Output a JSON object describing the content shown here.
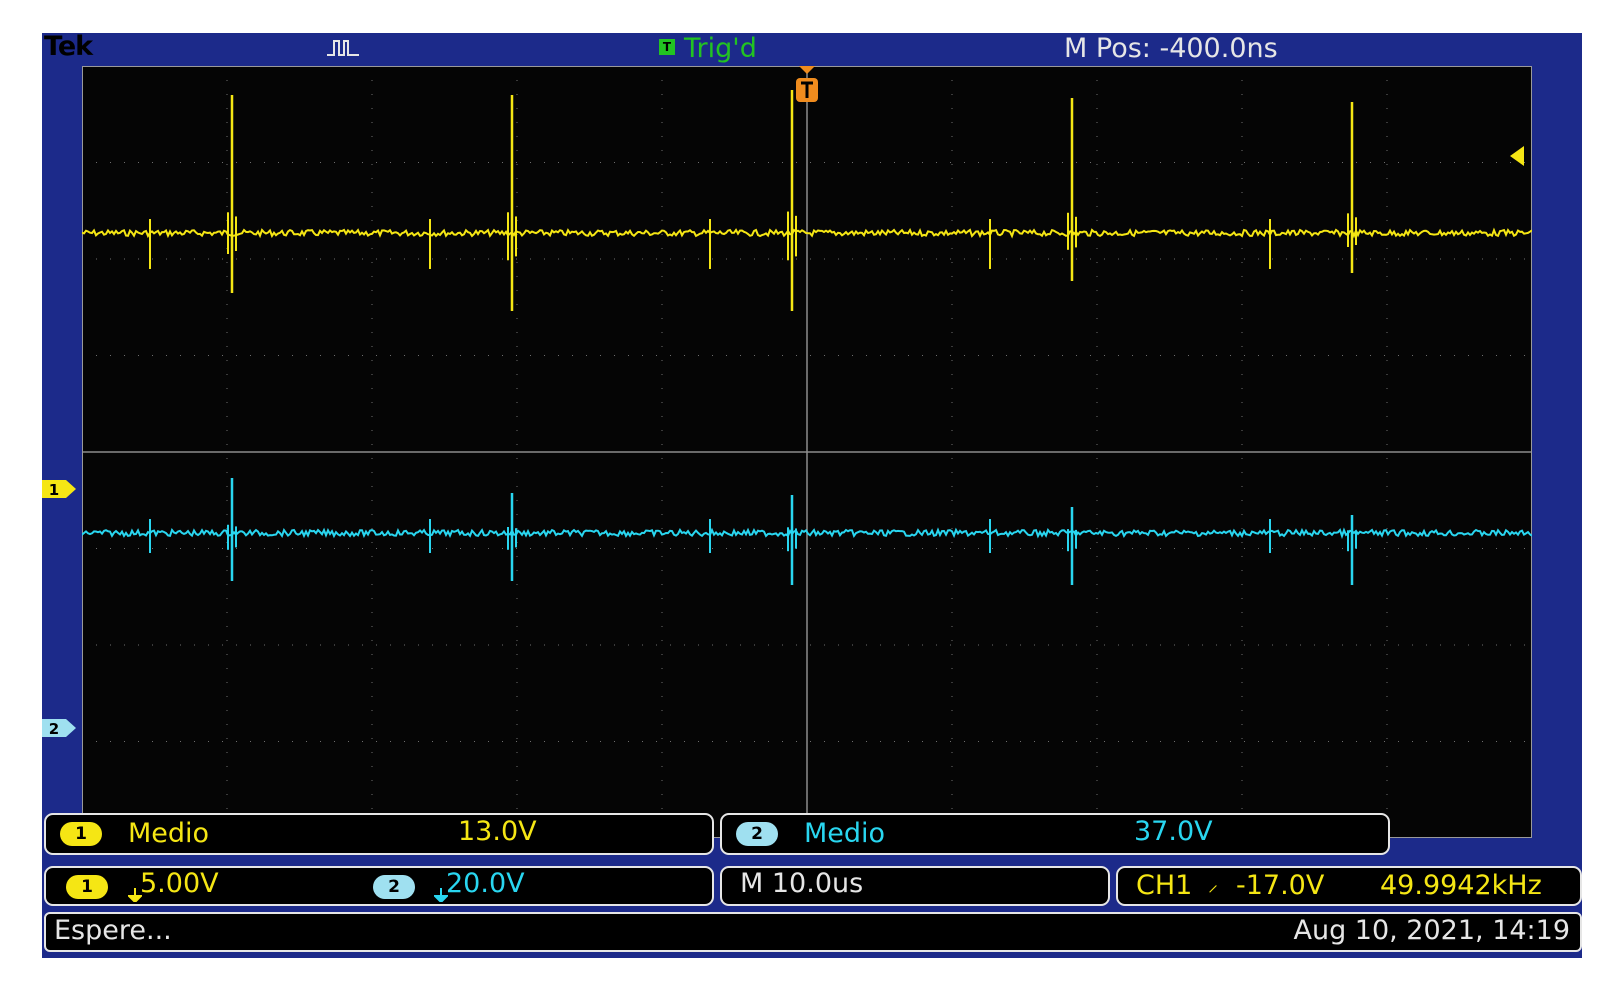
{
  "header": {
    "brand": "Tek",
    "trigger_state": "Trig'd",
    "trigger_badge": "T",
    "horizontal_position": "M Pos: -400.0ns"
  },
  "channels": {
    "ch1": {
      "badge": "1",
      "color": "#f5e614",
      "meas_label": "Medio",
      "meas_value": "13.0V",
      "scale": "5.00V"
    },
    "ch2": {
      "badge": "2",
      "color": "#29d6f0",
      "meas_label": "Medio",
      "meas_value": "37.0V",
      "scale": "20.0V"
    }
  },
  "timebase": "M 10.0us",
  "trigger": {
    "source": "CH1",
    "slope_symbol": "⸝",
    "level": "-17.0V",
    "frequency": "49.9942kHz"
  },
  "status": {
    "message": "Espere...",
    "datetime": "Aug 10, 2021, 14:19"
  },
  "icons": {
    "acquisition": "pulse-icon",
    "trigger_position": "trigger-marker-icon",
    "trigger_level": "trigger-level-arrow-icon"
  }
}
